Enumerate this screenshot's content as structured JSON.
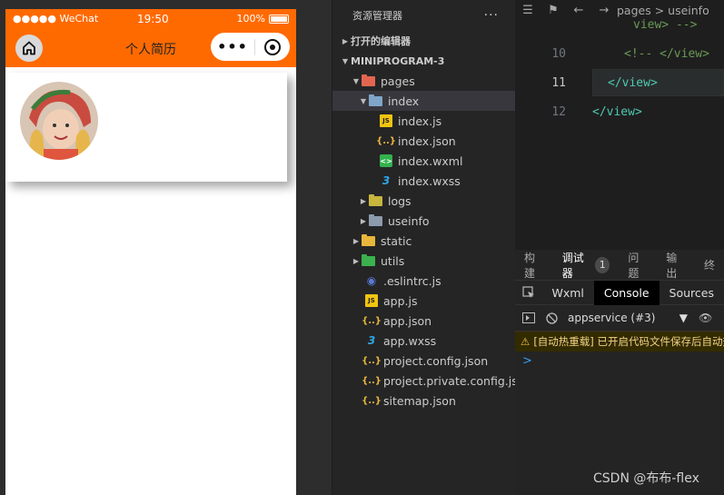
{
  "simulator": {
    "status": {
      "signal": "●●●●● WeChat",
      "time": "19:50",
      "battery": "100%"
    },
    "nav_title": "个人简历",
    "capsule_menu": "•••"
  },
  "explorer": {
    "title": "资源管理器",
    "more": "···",
    "open_editors": "打开的编辑器",
    "project": "MINIPROGRAM-3",
    "tree": [
      {
        "label": "pages"
      },
      {
        "label": "index"
      },
      {
        "label": "index.js"
      },
      {
        "label": "index.json"
      },
      {
        "label": "index.wxml"
      },
      {
        "label": "index.wxss"
      },
      {
        "label": "logs"
      },
      {
        "label": "useinfo"
      },
      {
        "label": "static"
      },
      {
        "label": "utils"
      },
      {
        "label": ".eslintrc.js"
      },
      {
        "label": "app.js"
      },
      {
        "label": "app.json"
      },
      {
        "label": "app.wxss"
      },
      {
        "label": "project.config.json"
      },
      {
        "label": "project.private.config.js..."
      },
      {
        "label": "sitemap.json"
      }
    ]
  },
  "editor": {
    "breadcrumb": "pages > useinfo",
    "lines": [
      {
        "num": "",
        "text": "view> -->"
      },
      {
        "num": "10",
        "text": "<!-- </view>"
      },
      {
        "num": "11",
        "text": "</view>"
      },
      {
        "num": "12",
        "text": "</view>"
      }
    ]
  },
  "devtools": {
    "tabs": [
      "构建",
      "调试器",
      "问题",
      "输出",
      "终"
    ],
    "badge": "1",
    "subtabs": [
      "Wxml",
      "Console",
      "Sources"
    ],
    "context": "appservice (#3)",
    "warning": "[自动热重载] 已开启代码文件保存后自动热重载",
    "prompt": ">"
  },
  "watermark": "CSDN @布布-flex"
}
